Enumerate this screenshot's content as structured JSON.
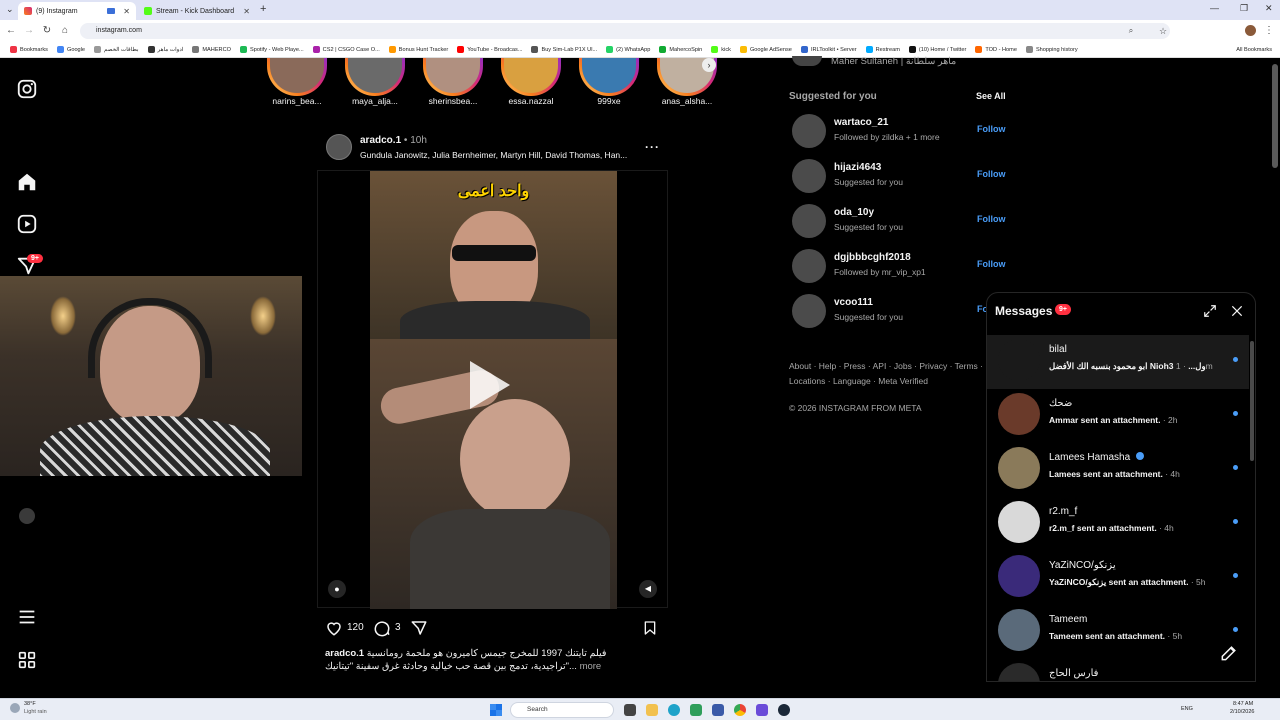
{
  "browser": {
    "tabs": [
      {
        "title": "(9) Instagram",
        "active": true
      },
      {
        "title": "Stream - Kick Dashboard",
        "active": false
      }
    ],
    "url": "instagram.com",
    "all_bookmarks": "All Bookmarks",
    "bookmarks": [
      "Bookmarks",
      "Google",
      "بطاقات الخصم",
      "ادوات ماهر",
      "MAHERCO",
      "Spotify - Web Playe...",
      "CS2 | CSGO Case O...",
      "Bonus Hunt Tracker",
      "YouTube - Broadcas...",
      "Buy Sim-Lab P1X Ul...",
      "(2) WhatsApp",
      "MahercoSpin",
      "kick",
      "Google AdSense",
      "IRLToolkit • Server",
      "Restream",
      "(10) Home / Twitter",
      "TOD - Home",
      "Shopping history"
    ]
  },
  "sidebar": {
    "notification_badge": "9+"
  },
  "stories": [
    "narins_bea...",
    "maya_alja...",
    "sherinsbea...",
    "essa.nazzal",
    "999xe",
    "anas_alsha..."
  ],
  "post": {
    "username": "aradco.1",
    "time": "10h",
    "collaborators": "Gundula Janowitz, Julia Bernheimer, Martyn Hill, David Thomas, Han...",
    "overlay_text": "واحد اعمى",
    "likes": "120",
    "comments": "3",
    "caption_user": "aradco.1",
    "caption_line1": "فيلم تايتنك 1997 للمخرج جيمس كاميرون هو ملحمة رومانسية",
    "caption_line2": "تراجيدية، تدمج بين قصة حب خيالية وحادثة غرق سفينة \"تيتانيك\"...",
    "more": "more"
  },
  "right": {
    "top_user": "Maher Sultaneh | ماهر سلطانة",
    "suggested_title": "Suggested for you",
    "see_all": "See All",
    "suggestions": [
      {
        "name": "wartaco_21",
        "sub": "Followed by zildka + 1 more",
        "action": "Follow"
      },
      {
        "name": "hijazi4643",
        "sub": "Suggested for you",
        "action": "Follow"
      },
      {
        "name": "oda_10y",
        "sub": "Suggested for you",
        "action": "Follow"
      },
      {
        "name": "dgjbbbcghf2018",
        "sub": "Followed by mr_vip_xp1",
        "action": "Follow"
      },
      {
        "name": "vcoo111",
        "sub": "Suggested for you",
        "action": "Fo"
      }
    ],
    "footer_line1": "About · Help · Press · API · Jobs · Privacy · Terms ·",
    "footer_line2": "Locations · Language · Meta Verified",
    "copyright": "© 2026 INSTAGRAM FROM META"
  },
  "messages": {
    "title": "Messages",
    "badge": "9+",
    "conversations": [
      {
        "name": "bilal",
        "preview": "ابو محمود بنسبه الك الأفضل Nioh3 ول...",
        "time": "· 1m"
      },
      {
        "name": "ضحك",
        "preview": "Ammar sent an attachment.",
        "time": "· 2h"
      },
      {
        "name": "Lamees Hamasha",
        "preview": "Lamees sent an attachment.",
        "time": "· 4h",
        "verified": true
      },
      {
        "name": "r2.m_f",
        "preview": "r2.m_f sent an attachment.",
        "time": "· 4h"
      },
      {
        "name": "YaZiNCO/يزنكو",
        "preview": "YaZiNCO/يزنكو sent an attachment.",
        "time": "· 5h"
      },
      {
        "name": "Tameem",
        "preview": "Tameem sent an attachment.",
        "time": "· 5h"
      },
      {
        "name": "فارس الحاج",
        "preview": "",
        "time": ""
      }
    ]
  },
  "taskbar": {
    "weather_temp": "38°F",
    "weather_desc": "Light rain",
    "search": "Search",
    "lang": "ENG",
    "time": "8:47 AM",
    "date": "2/10/2026"
  },
  "colors": {
    "ig_blue": "#4a9df8",
    "badge_red": "#ff3040",
    "bg": "#000000"
  }
}
